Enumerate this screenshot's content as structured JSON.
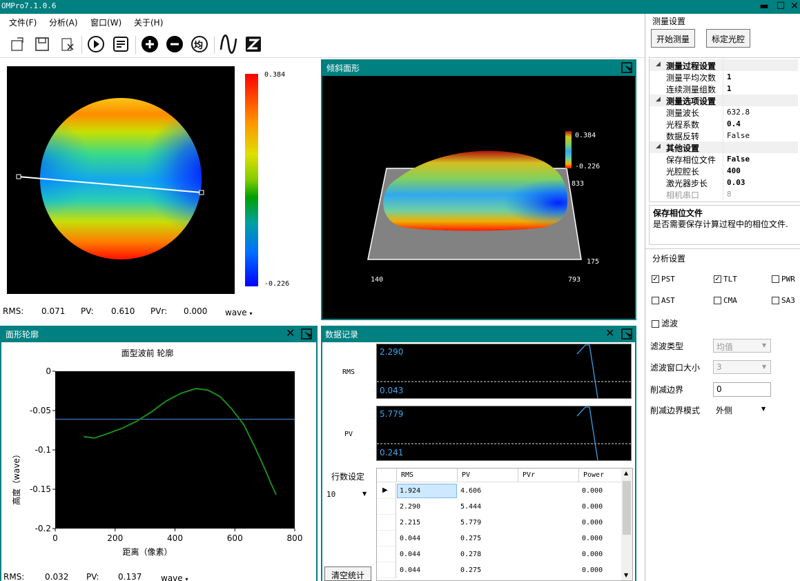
{
  "window": {
    "title": "OMPro7.1.0.6",
    "min": "▬",
    "max": "☐",
    "close": "✕"
  },
  "menu": [
    "文件(F)",
    "分析(A)",
    "窗口(W)",
    "关于(H)"
  ],
  "toolbar_labels": {
    "avg": "均"
  },
  "surface": {
    "cbar_max": "0.384",
    "cbar_min": "-0.226",
    "rms_label": "RMS:",
    "rms": "0.071",
    "pv_label": "PV:",
    "pv": "0.610",
    "pvr_label": "PVr:",
    "pvr": "0.000",
    "unit": "wave"
  },
  "tilt": {
    "title": "倾斜面形",
    "cbar_max": "0.384",
    "cbar_min": "-0.226",
    "ax_833": "833",
    "ax_175": "175",
    "ax_140": "140",
    "ax_793": "793"
  },
  "profile": {
    "panel_title": "面形轮廓",
    "rms_label": "RMS:",
    "rms": "0.032",
    "pv_label": "PV:",
    "pv": "0.137",
    "unit": "wave"
  },
  "chart_data": {
    "type": "line",
    "title": "面型波前 轮廓",
    "xlabel": "距离（像素）",
    "ylabel": "高度（wave）",
    "xlim": [
      0,
      800
    ],
    "ylim": [
      -0.2,
      0
    ],
    "xticks": [
      "0",
      "200",
      "400",
      "600",
      "800"
    ],
    "yticks": [
      "0",
      "-0.05",
      "-0.1",
      "-0.15",
      "-0.2"
    ],
    "reference_line_y": -0.061,
    "grid": false,
    "series": [
      {
        "color": "#1a8c1a",
        "x": [
          95,
          130,
          170,
          220,
          270,
          320,
          370,
          420,
          470,
          510,
          550,
          590,
          630,
          670,
          700,
          720,
          738
        ],
        "y": [
          -0.083,
          -0.085,
          -0.08,
          -0.073,
          -0.064,
          -0.052,
          -0.038,
          -0.028,
          -0.022,
          -0.024,
          -0.032,
          -0.048,
          -0.068,
          -0.099,
          -0.124,
          -0.142,
          -0.157
        ]
      }
    ]
  },
  "datarec": {
    "title": "数据记录",
    "rms_label": "RMS",
    "rms_max": "2.290",
    "rms_min": "0.043",
    "pv_label": "PV",
    "pv_max": "5.779",
    "pv_min": "0.241",
    "rows_label": "行数设定",
    "rows_value": "10",
    "clear_btn": "清空统计",
    "columns": [
      "RMS",
      "PV",
      "PVr",
      "Power"
    ],
    "rows": [
      [
        "1.924",
        "4.606",
        "",
        "0.000"
      ],
      [
        "2.290",
        "5.444",
        "",
        "0.000"
      ],
      [
        "2.215",
        "5.779",
        "",
        "0.000"
      ],
      [
        "0.044",
        "0.275",
        "",
        "0.000"
      ],
      [
        "0.044",
        "0.278",
        "",
        "0.000"
      ],
      [
        "0.044",
        "0.275",
        "",
        "0.000"
      ]
    ]
  },
  "settings": {
    "title": "测量设置",
    "start_btn": "开始测量",
    "calib_btn": "标定光腔",
    "groups": [
      {
        "name": "测量过程设置",
        "items": [
          {
            "k": "测量平均次数",
            "v": "1",
            "bold": true
          },
          {
            "k": "连续测量组数",
            "v": "1",
            "bold": true
          }
        ]
      },
      {
        "name": "测量选项设置",
        "items": [
          {
            "k": "测量波长",
            "v": "632.8"
          },
          {
            "k": "光程系数",
            "v": "0.4",
            "bold": true
          },
          {
            "k": "数据反转",
            "v": "False"
          }
        ]
      },
      {
        "name": "其他设置",
        "items": [
          {
            "k": "保存相位文件",
            "v": "False",
            "bold": true
          },
          {
            "k": "光腔腔长",
            "v": "400",
            "bold": true
          },
          {
            "k": "激光器步长",
            "v": "0.03",
            "bold": true
          },
          {
            "k": "相机串口",
            "v": "8",
            "gray": true
          }
        ]
      }
    ],
    "desc_title": "保存相位文件",
    "desc_text": "是否需要保存计算过程中的相位文件."
  },
  "analysis": {
    "title": "分析设置",
    "checks": [
      {
        "label": "PST",
        "checked": true
      },
      {
        "label": "TLT",
        "checked": true
      },
      {
        "label": "PWR",
        "checked": false
      },
      {
        "label": "AST",
        "checked": false
      },
      {
        "label": "CMA",
        "checked": false
      },
      {
        "label": "SA3",
        "checked": false
      }
    ],
    "filter_label": "滤波",
    "filter_type_label": "滤波类型",
    "filter_type": "均值",
    "filter_win_label": "滤波窗口大小",
    "filter_win": "3",
    "trim_label": "削减边界",
    "trim": "0",
    "trim_mode_label": "削减边界模式",
    "trim_mode": "外侧"
  }
}
